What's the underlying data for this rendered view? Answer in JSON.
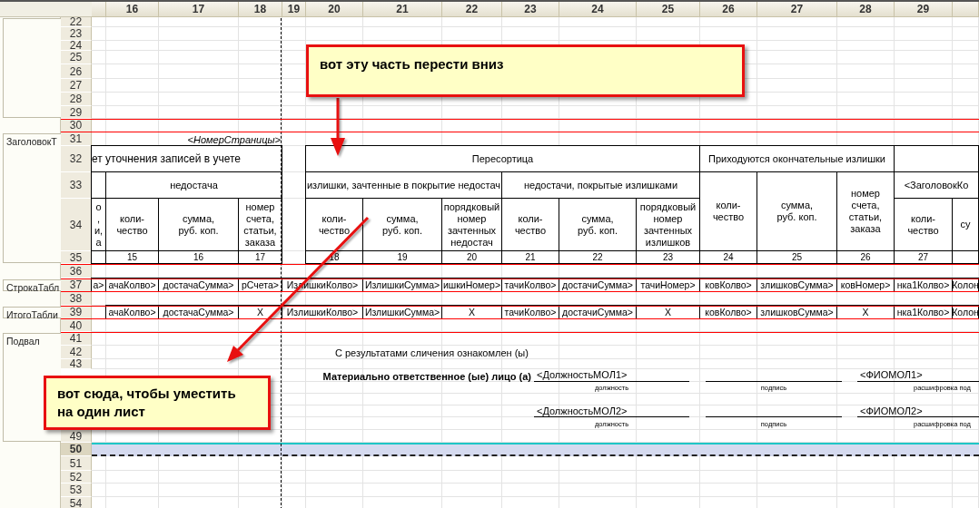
{
  "column_headers": [
    "16",
    "17",
    "18",
    "19",
    "20",
    "21",
    "22",
    "23",
    "24",
    "25",
    "26",
    "27",
    "28",
    "29"
  ],
  "row_numbers_top": [
    {
      "label": "22",
      "selected": false
    },
    {
      "label": "23",
      "selected": false
    },
    {
      "label": "24",
      "selected": false
    },
    {
      "label": "25",
      "selected": false
    },
    {
      "label": "26",
      "selected": false
    },
    {
      "label": "27",
      "selected": false
    },
    {
      "label": "28",
      "selected": false
    },
    {
      "label": "29",
      "selected": false
    },
    {
      "label": "30",
      "selected": false
    },
    {
      "label": "31",
      "selected": false
    },
    {
      "label": "32",
      "selected": false
    },
    {
      "label": "33",
      "selected": false
    },
    {
      "label": "34",
      "selected": false
    },
    {
      "label": "35",
      "selected": false
    },
    {
      "label": "36",
      "selected": false
    },
    {
      "label": "37",
      "selected": false
    },
    {
      "label": "38",
      "selected": false
    },
    {
      "label": "39",
      "selected": false
    },
    {
      "label": "40",
      "selected": false
    },
    {
      "label": "41",
      "selected": false
    },
    {
      "label": "42",
      "selected": false
    },
    {
      "label": "43",
      "selected": false
    }
  ],
  "row_numbers_bottom": [
    {
      "label": "49",
      "selected": false
    },
    {
      "label": "50",
      "selected": true
    },
    {
      "label": "51",
      "selected": false
    },
    {
      "label": "52",
      "selected": false
    },
    {
      "label": "53",
      "selected": false
    },
    {
      "label": "54",
      "selected": false
    }
  ],
  "groups": [
    "ЗаголовокТ",
    "СтрокаТабл",
    "ИтогоТабли",
    "Подвал"
  ],
  "page_number": "<НомерСтраницы>",
  "header_cells": [
    "ет уточнения записей в учете",
    "Пересортица",
    "Приходуются окончательные излишки",
    "недостача",
    "излишки, зачтенные в покрытие недостач",
    "недостачи, покрытые излишками",
    "коли-\nчество",
    "сумма,\nруб. коп.",
    "номер\nсчета,\nстатьи,\nзаказа",
    "<ЗаголовокКо",
    "о\n,\nи,\nа",
    "коли-\nчество",
    "сумма,\nруб. коп.",
    "номер\nсчета,\nстатьи,\nзаказа",
    "коли-\nчество",
    "сумма,\nруб. коп.",
    "порядковый номер зачтенных недостач",
    "коли-\nчество",
    "сумма,\nруб. коп.",
    "порядковый номер зачтенных излишков",
    "коли-\nчество",
    "су"
  ],
  "column_numbers": [
    "15",
    "16",
    "17",
    "18",
    "19",
    "20",
    "21",
    "22",
    "23",
    "24",
    "25",
    "26",
    "27"
  ],
  "detail_row": [
    "а>",
    "ачаКолво>",
    "достачаСумма>",
    "рСчета>",
    "ИзлишкиКолво>",
    "ИзлишкиСумма>",
    "ишкиНомер>",
    "тачиКолво>",
    "достачиСумма>",
    "тачиНомер>",
    "ковКолво>",
    "злишковСумма>",
    "ковНомер>",
    "нка1Колво>",
    "Колон"
  ],
  "total_row": [
    "ачаКолво>",
    "достачаСумма>",
    "X",
    "ИзлишкиКолво>",
    "ИзлишкиСумма>",
    "X",
    "тачиКолво>",
    "достачиСумма>",
    "X",
    "ковКолво>",
    "злишковСумма>",
    "X",
    "нка1Колво>",
    "Колон"
  ],
  "footer": {
    "acknowledgement": "С результатами сличения ознакомлен (ы)",
    "responsible_label": "Материально ответственное (ые) лицо (а)",
    "signatures": [
      {
        "position": "<ДолжностьМОЛ1>",
        "name": "<ФИОМОЛ1>",
        "position_caption": "должность",
        "signature_caption": "подпись",
        "name_caption": "расшифровка под"
      },
      {
        "position": "<ДолжностьМОЛ2>",
        "name": "<ФИОМОЛ2>",
        "position_caption": "должность",
        "signature_caption": "подпись",
        "name_caption": "расшифровка под"
      }
    ]
  },
  "callouts": [
    "вот эту часть перести вниз",
    "вот сюда, чтобы уместить на один лист"
  ]
}
